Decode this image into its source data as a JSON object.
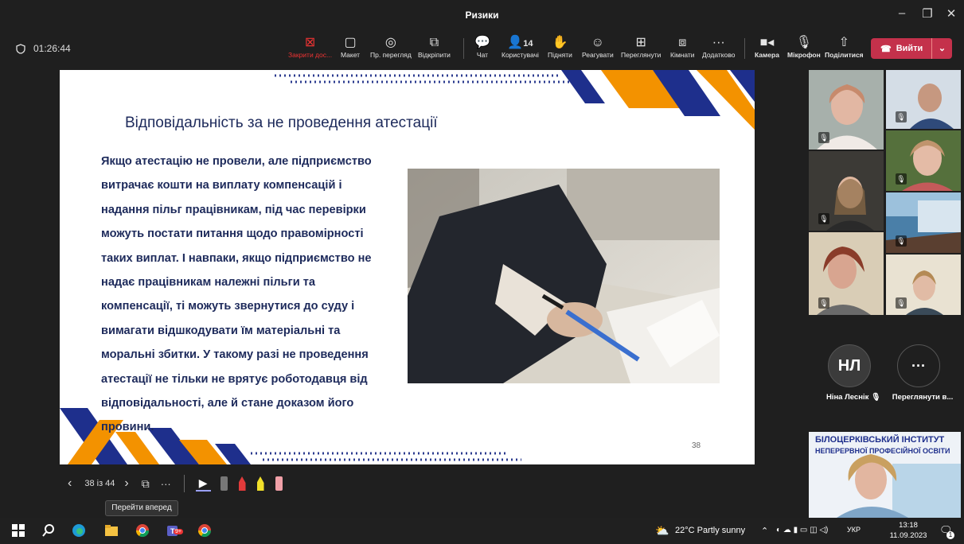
{
  "window": {
    "title": "Ризики"
  },
  "toolbar": {
    "timer": "01:26:44",
    "items": [
      {
        "label": "Закрити дос...",
        "icon": "close-share-icon"
      },
      {
        "label": "Макет",
        "icon": "layout-icon"
      },
      {
        "label": "Пр. перегляд",
        "icon": "presenter-view-icon"
      },
      {
        "label": "Відкріпити",
        "icon": "pop-out-icon"
      },
      {
        "label": "Чат",
        "icon": "chat-icon"
      },
      {
        "label": "Користувачі",
        "icon": "people-icon",
        "count": "14"
      },
      {
        "label": "Підняти",
        "icon": "raise-hand-icon"
      },
      {
        "label": "Реагувати",
        "icon": "react-icon"
      },
      {
        "label": "Переглянути",
        "icon": "view-icon"
      },
      {
        "label": "Кімнати",
        "icon": "rooms-icon"
      },
      {
        "label": "Додатково",
        "icon": "more-icon"
      },
      {
        "label": "Камера",
        "icon": "camera-icon"
      },
      {
        "label": "Мікрофон",
        "icon": "mic-icon"
      },
      {
        "label": "Поділитися",
        "icon": "share-icon"
      }
    ],
    "leave_label": "Вийти"
  },
  "slide": {
    "title": "Відповідальність за не проведення атестації",
    "lines": [
      "Якщо атестацію не провели, але підприємство",
      "витрачає кошти на виплату компенсацій і",
      "надання пільг працівникам, під час перевірки",
      "можуть постати питання щодо правомірності",
      "таких виплат. І навпаки, якщо підприємство не",
      "надає працівникам належні пільги та",
      "компенсації, ті можуть звернутися до суду і",
      "вимагати відшкодувати їм матеріальні та",
      "моральні збитки. У такому разі не проведення",
      "атестації не тільки не врятує роботодавця від",
      "відповідальності, але й стане доказом його",
      "провини."
    ],
    "page_number": "38",
    "colors": {
      "navy": "#1e2f8c",
      "orange": "#f39200",
      "text": "#1d2a5b"
    }
  },
  "participants": {
    "initials": "НЛ",
    "initials_name": "Ніна Леснік",
    "more_label": "Переглянути в...",
    "presenter_banner_line1": "БІЛОЦЕРКІВСЬКИЙ ІНСТИТУТ",
    "presenter_banner_line2": "НЕПЕРЕРВНОЇ ПРОФЕСІЙНОЇ ОСВІТИ"
  },
  "presenter_controls": {
    "page": "38 із 44",
    "tooltip": "Перейти вперед"
  },
  "taskbar": {
    "weather": "22°C  Partly sunny",
    "lang": "УКР",
    "time": "13:18",
    "date": "11.09.2023",
    "teams_badge": "9+",
    "notif_count": "1"
  }
}
